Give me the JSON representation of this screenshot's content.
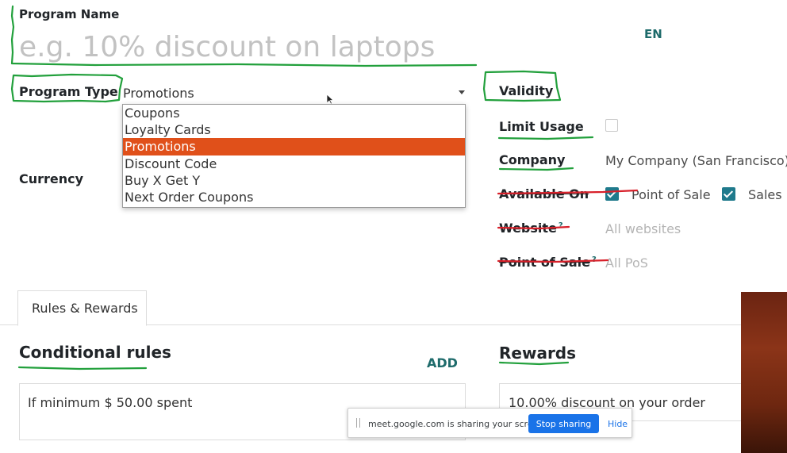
{
  "program_name": {
    "label": "Program Name",
    "placeholder": "e.g. 10% discount on laptops",
    "language": "EN"
  },
  "program_type": {
    "label": "Program Type",
    "value": "Promotions",
    "options": [
      "Coupons",
      "Loyalty Cards",
      "Promotions",
      "Discount Code",
      "Buy X Get Y",
      "Next Order Coupons"
    ],
    "selected_index": 2
  },
  "currency": {
    "label": "Currency"
  },
  "validity": {
    "title": "Validity",
    "limit_usage_label": "Limit Usage",
    "limit_usage_checked": false,
    "company_label": "Company",
    "company_value": "My Company (San Francisco)",
    "available_on_label": "Available On",
    "pos_option_label": "Point of Sale",
    "pos_checked": true,
    "sales_option_label": "Sales",
    "sales_checked": true,
    "website_label": "Website",
    "website_value": "All websites",
    "pos_label": "Point of Sale",
    "pos_value": "All PoS",
    "help_mark": "?"
  },
  "tabs": [
    {
      "label": "Rules & Rewards",
      "active": true
    }
  ],
  "conditional_rules": {
    "title": "Conditional rules",
    "add_label": "ADD",
    "rules": [
      "If minimum $ 50.00 spent"
    ]
  },
  "rewards": {
    "title": "Rewards",
    "items": [
      "10.00% discount on your order"
    ]
  },
  "share_bar": {
    "message": "meet.google.com is sharing your screen.",
    "stop_label": "Stop sharing",
    "hide_label": "Hide"
  },
  "colors": {
    "accent_teal": "#1e6b6b",
    "selected_option": "#e0501a",
    "checkbox": "#1f7a8c",
    "annotation_green": "#22a03c",
    "annotation_red": "#d8202a",
    "stop_button": "#1a73e8"
  }
}
